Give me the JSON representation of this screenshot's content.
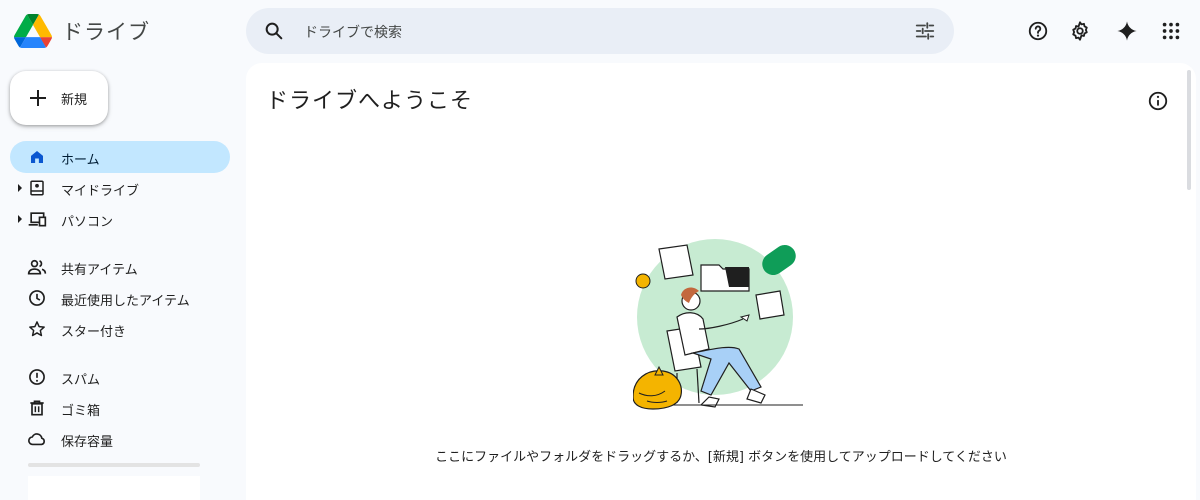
{
  "app": {
    "title": "ドライブ"
  },
  "search": {
    "placeholder": "ドライブで検索",
    "icon": "search-icon",
    "filter_icon": "tune-icon"
  },
  "header_icons": [
    "help-icon",
    "settings-icon",
    "gemini-sparkle-icon",
    "apps-grid-icon"
  ],
  "new_button": {
    "label": "新規"
  },
  "sidebar": {
    "items": [
      {
        "label": "ホーム",
        "icon": "home-icon",
        "active": true
      },
      {
        "label": "マイドライブ",
        "icon": "my-drive-icon",
        "expandable": true
      },
      {
        "label": "パソコン",
        "icon": "computers-icon",
        "expandable": true
      },
      {
        "label": "共有アイテム",
        "icon": "shared-icon"
      },
      {
        "label": "最近使用したアイテム",
        "icon": "recent-clock-icon"
      },
      {
        "label": "スター付き",
        "icon": "star-icon"
      },
      {
        "label": "スパム",
        "icon": "spam-icon"
      },
      {
        "label": "ゴミ箱",
        "icon": "trash-icon"
      },
      {
        "label": "保存容量",
        "icon": "cloud-icon"
      }
    ]
  },
  "main": {
    "title": "ドライブへようこそ",
    "empty_message": "ここにファイルやフォルダをドラッグするか、[新規] ボタンを使用してアップロードしてください"
  },
  "colors": {
    "background": "#f8fafd",
    "search_bg": "#e9eef6",
    "active_nav": "#c2e7ff",
    "drive_green": "#0f9d58",
    "drive_yellow": "#f4b400",
    "drive_blue": "#4285f4",
    "illustration_green": "#c7ebd2"
  }
}
